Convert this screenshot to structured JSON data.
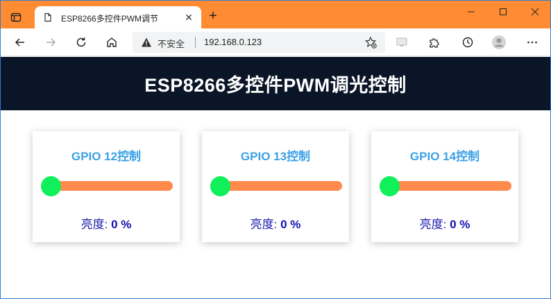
{
  "browser": {
    "tab_title": "ESP8266多控件PWM调节",
    "tab_close": "✕",
    "new_tab": "+",
    "security_label": "不安全",
    "url": "192.168.0.123"
  },
  "page": {
    "title": "ESP8266多控件PWM调光控制"
  },
  "controls": [
    {
      "title": "GPIO 12控制",
      "brightness_label": "亮度:",
      "brightness_value": "0 %",
      "level": 0
    },
    {
      "title": "GPIO 13控制",
      "brightness_label": "亮度:",
      "brightness_value": "0 %",
      "level": 0
    },
    {
      "title": "GPIO 14控制",
      "brightness_label": "亮度:",
      "brightness_value": "0 %",
      "level": 0
    }
  ],
  "colors": {
    "tabbar": "#ff8c32",
    "header_bg": "#0a1628",
    "card_title": "#3aa0e6",
    "slider_track": "#ff8a4c",
    "slider_thumb": "#0ff05a",
    "brightness_text": "#1a1aa8"
  },
  "icons": {
    "tab_actions": "tab-actions-icon",
    "page": "page-icon",
    "back": "back-arrow-icon",
    "forward": "forward-arrow-icon",
    "refresh": "refresh-icon",
    "home": "home-icon",
    "warning": "warning-icon",
    "favorites": "add-favorite-icon",
    "translate": "translate-icon",
    "extensions": "puzzle-icon",
    "history": "history-icon",
    "profile": "profile-icon",
    "more": "more-icon"
  }
}
